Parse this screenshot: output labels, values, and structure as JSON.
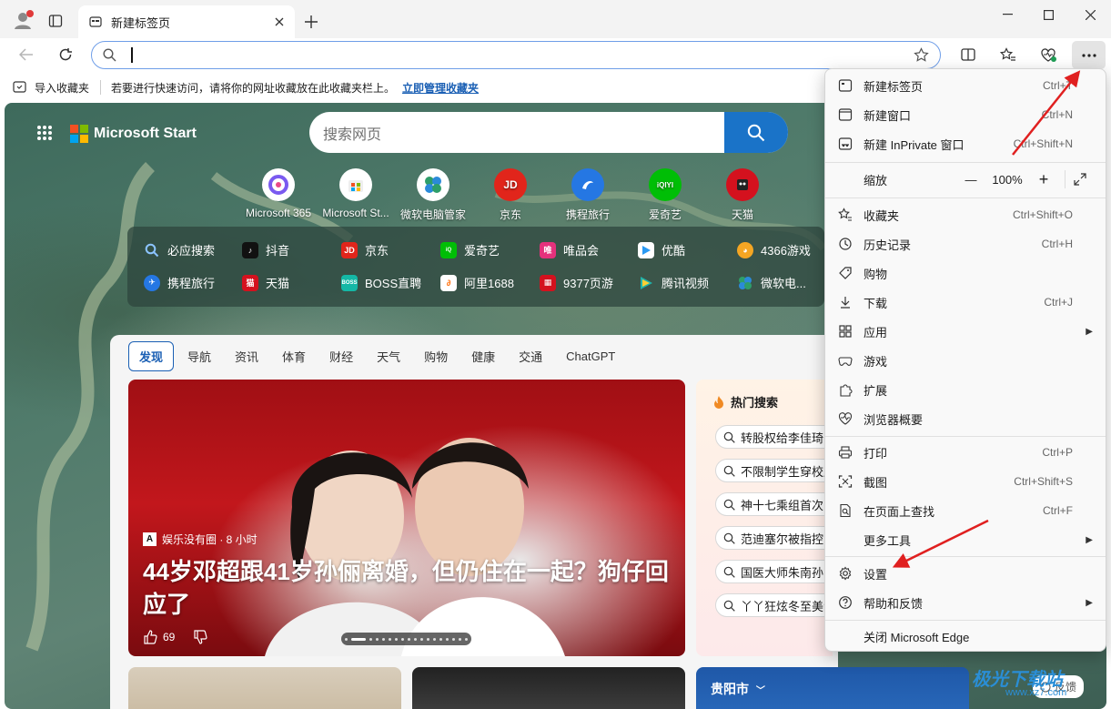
{
  "tab": {
    "title": "新建标签页"
  },
  "favbar": {
    "import_label": "导入收藏夹",
    "hint": "若要进行快速访问，请将你的网址收藏放在此收藏夹栏上。",
    "manage_link": "立即管理收藏夹"
  },
  "page": {
    "brand": "Microsoft Start",
    "search_placeholder": "搜索网页",
    "apps": [
      {
        "label": "Microsoft 365",
        "color": "#6b4fd8"
      },
      {
        "label": "Microsoft St...",
        "color": "#f25022"
      },
      {
        "label": "微软电脑管家",
        "color": "#2e9e6a"
      },
      {
        "label": "京东",
        "color": "#e1251b",
        "glyph": "JD"
      },
      {
        "label": "携程旅行",
        "color": "#2577e3"
      },
      {
        "label": "爱奇艺",
        "color": "#00be06",
        "glyph": "iQIYI"
      },
      {
        "label": "天猫",
        "color": "#d4111e"
      }
    ],
    "quick_links": [
      {
        "label": "必应搜索",
        "color": "#1a73c8"
      },
      {
        "label": "抖音",
        "color": "#111111"
      },
      {
        "label": "京东",
        "color": "#e1251b"
      },
      {
        "label": "爱奇艺",
        "color": "#00be06"
      },
      {
        "label": "唯品会",
        "color": "#e5317c"
      },
      {
        "label": "优酷",
        "color": "#2a9af3"
      },
      {
        "label": "4366游戏",
        "color": "#f5a623"
      },
      {
        "label": "携程旅行",
        "color": "#2577e3"
      },
      {
        "label": "天猫",
        "color": "#d4111e"
      },
      {
        "label": "BOSS直聘",
        "color": "#14b8a6"
      },
      {
        "label": "阿里1688",
        "color": "#ff6a00"
      },
      {
        "label": "9377页游",
        "color": "#d4111e"
      },
      {
        "label": "腾讯视频",
        "color": "#20b2aa"
      },
      {
        "label": "微软电...",
        "color": "#2e9e6a"
      }
    ],
    "feed_tabs": [
      "发现",
      "导航",
      "资讯",
      "体育",
      "财经",
      "天气",
      "购物",
      "健康",
      "交通",
      "ChatGPT"
    ],
    "hero": {
      "source": "娱乐没有圈 · 8 小时",
      "title": "44岁邓超跟41岁孙俪离婚，但仍住在一起？狗仔回应了",
      "likes": "69"
    },
    "hot": {
      "header": "热门搜索",
      "items": [
        "转股权给李佳琦",
        "不限制学生穿校服",
        "神十七乘组首次",
        "范迪塞尔被指控",
        "国医大师朱南孙",
        "丫丫狂炫冬至美食"
      ]
    },
    "weather_city": "贵阳市",
    "feedback": "反馈"
  },
  "menu": {
    "items": [
      {
        "label": "新建标签页",
        "shortcut": "Ctrl+T",
        "icon": "new-tab-icon"
      },
      {
        "label": "新建窗口",
        "shortcut": "Ctrl+N",
        "icon": "new-window-icon"
      },
      {
        "label": "新建 InPrivate 窗口",
        "shortcut": "Ctrl+Shift+N",
        "icon": "inprivate-icon"
      },
      {
        "label": "收藏夹",
        "shortcut": "Ctrl+Shift+O",
        "icon": "favorites-icon"
      },
      {
        "label": "历史记录",
        "shortcut": "Ctrl+H",
        "icon": "history-icon"
      },
      {
        "label": "购物",
        "shortcut": "",
        "icon": "shopping-tag-icon"
      },
      {
        "label": "下载",
        "shortcut": "Ctrl+J",
        "icon": "download-icon"
      },
      {
        "label": "应用",
        "shortcut": "",
        "icon": "apps-icon"
      },
      {
        "label": "游戏",
        "shortcut": "",
        "icon": "games-icon"
      },
      {
        "label": "扩展",
        "shortcut": "",
        "icon": "extensions-icon"
      },
      {
        "label": "浏览器概要",
        "shortcut": "",
        "icon": "browser-essentials-icon"
      },
      {
        "label": "打印",
        "shortcut": "Ctrl+P",
        "icon": "print-icon"
      },
      {
        "label": "截图",
        "shortcut": "Ctrl+Shift+S",
        "icon": "screenshot-icon"
      },
      {
        "label": "在页面上查找",
        "shortcut": "Ctrl+F",
        "icon": "find-icon"
      },
      {
        "label": "更多工具",
        "shortcut": "",
        "icon": "more-tools-icon"
      },
      {
        "label": "设置",
        "shortcut": "",
        "icon": "settings-gear-icon"
      },
      {
        "label": "帮助和反馈",
        "shortcut": "",
        "icon": "help-icon"
      },
      {
        "label": "关闭 Microsoft Edge",
        "shortcut": "",
        "icon": "none"
      }
    ],
    "zoom_label": "缩放",
    "zoom_value": "100%"
  },
  "watermark": {
    "text": "极光下载站",
    "sub": "www.xz7.com"
  },
  "colors": {
    "accent": "#1a73c8",
    "annotation_arrow": "#e02020"
  }
}
